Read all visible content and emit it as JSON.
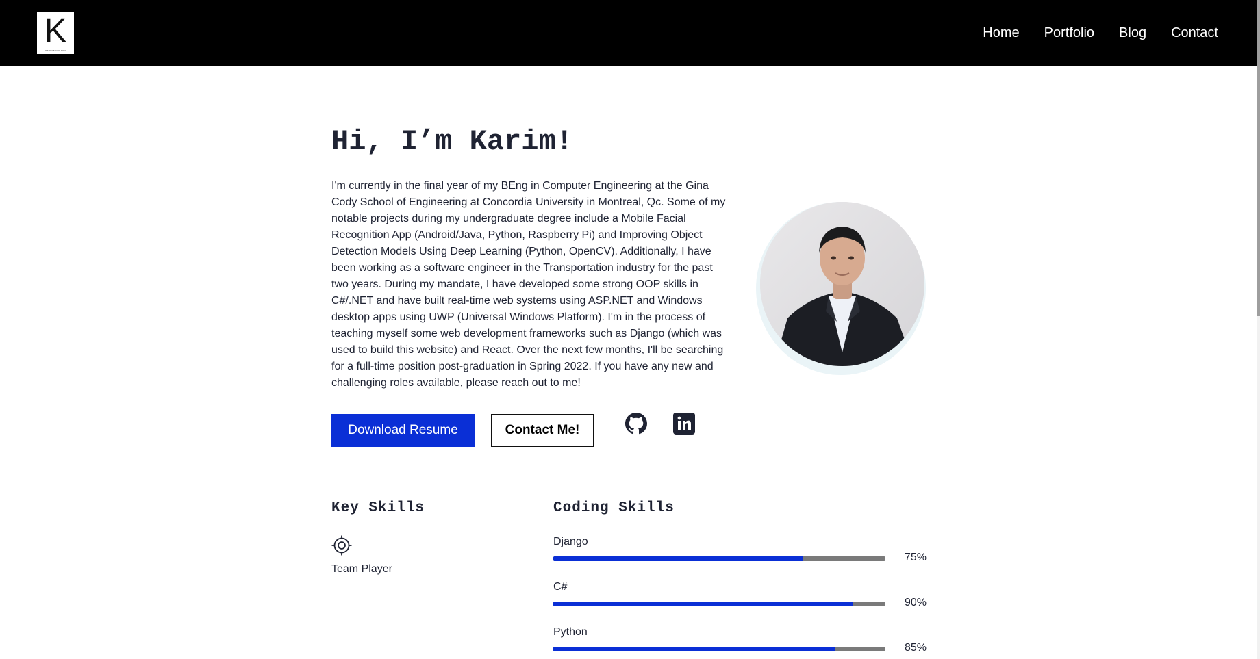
{
  "brand": {
    "logo_letter": "K",
    "logo_caption": "KARIM KHOULEIRI"
  },
  "nav": {
    "items": [
      "Home",
      "Portfolio",
      "Blog",
      "Contact"
    ]
  },
  "hero": {
    "title": "Hi, I’m Karim!",
    "intro": "I'm currently in the final year of my BEng in Computer Engineering at the Gina Cody School of Engineering at Concordia University in Montreal, Qc. Some of my notable projects during my undergraduate degree include a Mobile Facial Recognition App (Android/Java, Python, Raspberry Pi) and Improving Object Detection Models Using Deep Learning (Python, OpenCV). Additionally, I have been working as a software engineer in the Transportation industry for the past two years. During my mandate, I have developed some strong OOP skills in C#/.NET and have built real-time web systems using ASP.NET and Windows desktop apps using UWP (Universal Windows Platform). I'm in the process of teaching myself some web development frameworks such as Django (which was used to build this website) and React. Over the next few months, I'll be searching for a full-time position post-graduation in Spring 2022. If you have any new and challenging roles available, please reach out to me!",
    "primary_button": "Download Resume",
    "secondary_button": "Contact Me!",
    "social_icons": [
      "github-icon",
      "linkedin-icon"
    ]
  },
  "key_skills": {
    "heading": "Key Skills",
    "items": [
      {
        "icon": "target-icon",
        "label": "Team Player"
      }
    ]
  },
  "coding_skills": {
    "heading": "Coding Skills",
    "items": [
      {
        "name": "Django",
        "percent_label": "75%",
        "level": 75
      },
      {
        "name": "C#",
        "percent_label": "90%",
        "level": 90
      },
      {
        "name": "Python",
        "percent_label": "85%",
        "level": 85
      }
    ]
  },
  "colors": {
    "accent": "#0a2fd6",
    "navbar": "#000000",
    "text": "#1f2333",
    "track": "#7a7a7a"
  }
}
